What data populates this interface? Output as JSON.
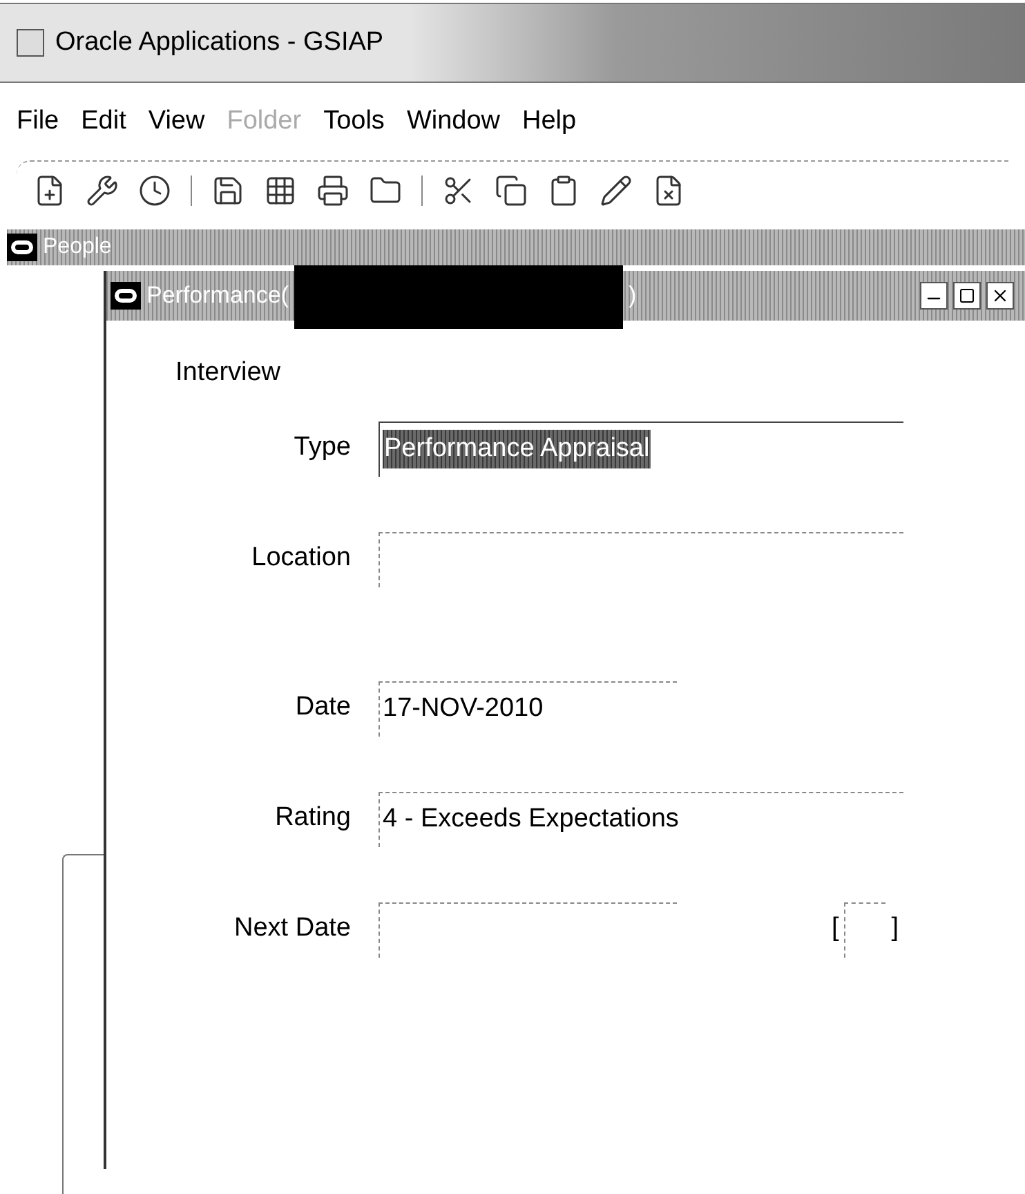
{
  "window": {
    "title": "Oracle Applications - GSIAP"
  },
  "menu": [
    {
      "label": "File",
      "disabled": false
    },
    {
      "label": "Edit",
      "disabled": false
    },
    {
      "label": "View",
      "disabled": false
    },
    {
      "label": "Folder",
      "disabled": true
    },
    {
      "label": "Tools",
      "disabled": false
    },
    {
      "label": "Window",
      "disabled": false
    },
    {
      "label": "Help",
      "disabled": false
    }
  ],
  "people_window": {
    "title": "People"
  },
  "dialog": {
    "title_start": "Performance(",
    "title_end": ")",
    "section": "Interview",
    "fields": [
      {
        "label": "Type",
        "kind": "wide",
        "value": "Performance Appraisal",
        "selected": true
      },
      {
        "label": "Location",
        "kind": "wide",
        "selected": false
      },
      {
        "label": "Date",
        "kind": "narrow",
        "value": "17-NOV-2010",
        "selected": false
      },
      {
        "label": "Rating",
        "kind": "wide",
        "value": "4 - Exceeds Expectations",
        "selected": false
      },
      {
        "label": "Next Date",
        "kind": "narrow",
        "selected": false
      }
    ],
    "bracket_open": "[",
    "bracket_close": "]"
  }
}
